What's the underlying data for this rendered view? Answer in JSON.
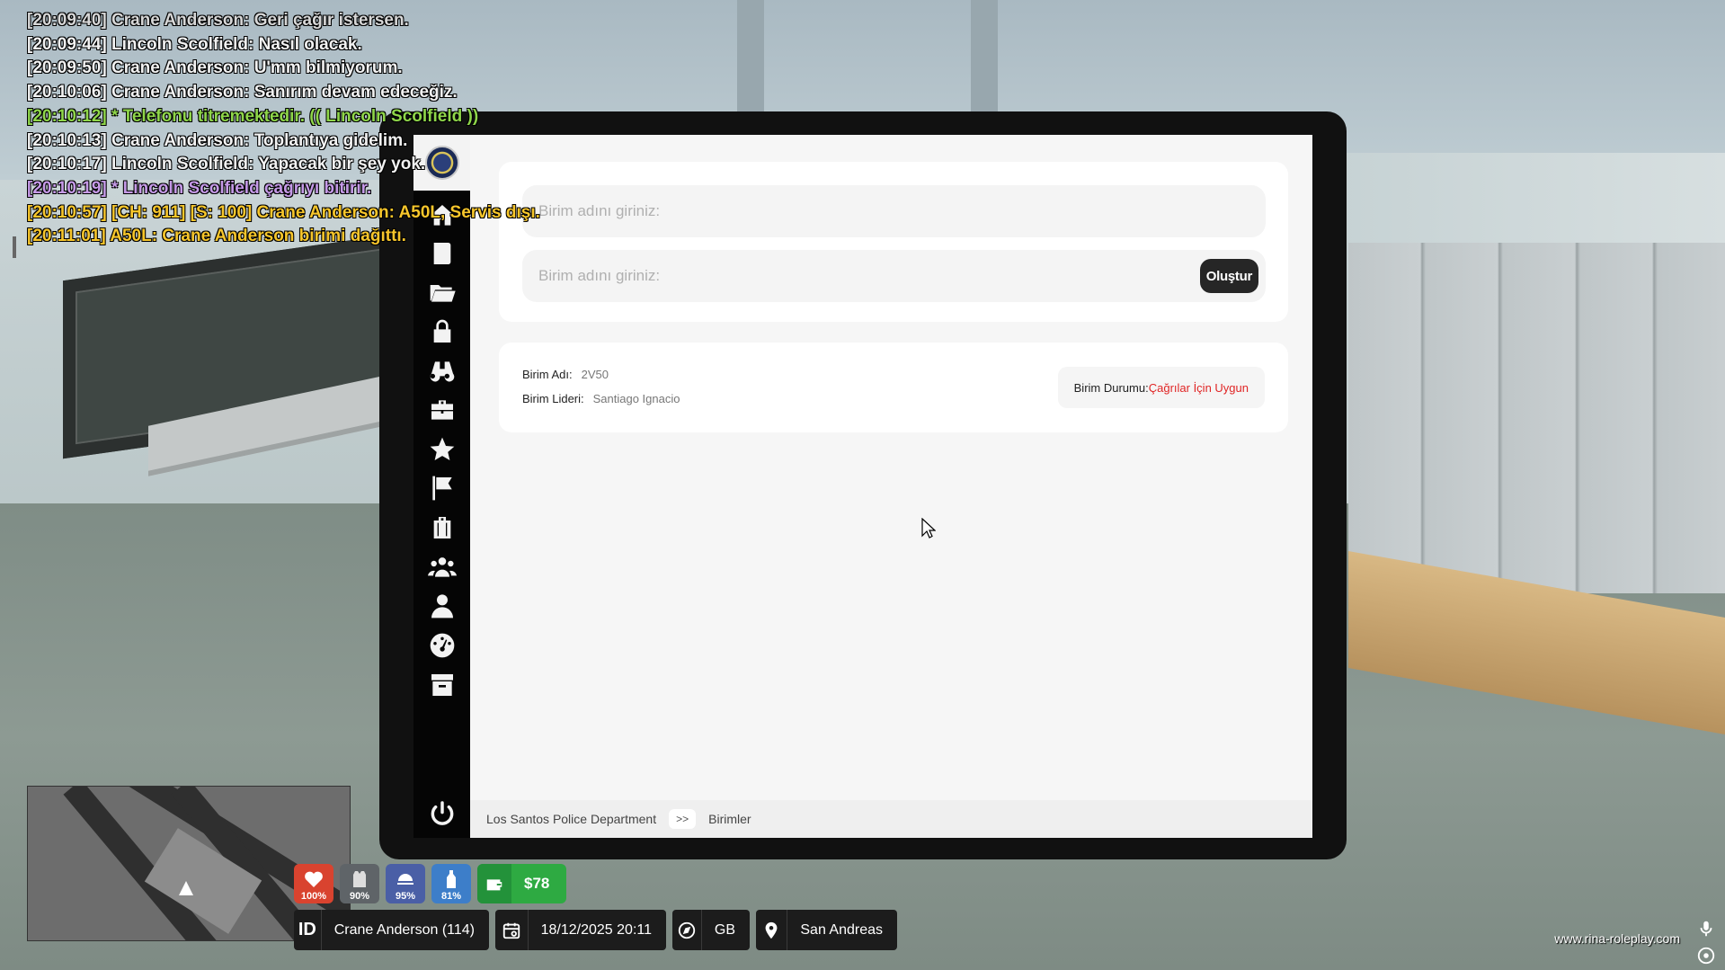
{
  "chat": [
    {
      "text": "[20:09:40] Crane Anderson: Geri çağır istersen.",
      "color": "grey"
    },
    {
      "text": "[20:09:44] Lincoln Scolfield: Nasıl olacak.",
      "color": "white"
    },
    {
      "text": "[20:09:50] Crane Anderson: U'mm bilmiyorum.",
      "color": "white"
    },
    {
      "text": "[20:10:06] Crane Anderson: Sanırım devam edeceğiz.",
      "color": "white"
    },
    {
      "text": "[20:10:12] * Telefonu titremektedir. (( Lincoln Scolfield ))",
      "color": "green"
    },
    {
      "text": "[20:10:13] Crane Anderson: Toplantıya gidelim.",
      "color": "white"
    },
    {
      "text": "[20:10:17] Lincoln Scolfield: Yapacak bir şey yok.",
      "color": "white"
    },
    {
      "text": "[20:10:19] * Lincoln Scolfield çağrıyı bitirir.",
      "color": "purple"
    },
    {
      "text": "[20:10:57] [CH: 911] [S: 100] Crane Anderson: A50L, Servis dışı.",
      "color": "yellow"
    },
    {
      "text": "[20:11:01] A50L: Crane Anderson birimi dağıttı.",
      "color": "yellow"
    }
  ],
  "tablet": {
    "sidebar_icons": [
      "home-icon",
      "book-icon",
      "folder-open-icon",
      "lock-icon",
      "binoculars-icon",
      "briefcase-icon",
      "star-icon",
      "flag-icon",
      "suitcase-icon",
      "users-icon",
      "user-icon",
      "tachometer-icon",
      "archive-icon"
    ],
    "form": {
      "field1_placeholder": "Birim adını giriniz:",
      "field2_placeholder": "Birim adını giriniz:",
      "create_label": "Oluştur"
    },
    "unit": {
      "name_label": "Birim Adı:",
      "name_value": "2V50",
      "leader_label": "Birim Lideri:",
      "leader_value": "Santiago Ignacio",
      "status_label": "Birim Durumu:",
      "status_value": "Çağrılar İçin Uygun"
    },
    "breadcrumb": {
      "root": "Los Santos Police Department",
      "separator": ">>",
      "current": "Birimler"
    }
  },
  "hud": {
    "stats": [
      {
        "name": "health",
        "value": "100%",
        "color": "#d9432f"
      },
      {
        "name": "armor",
        "value": "90%",
        "color": "#5f6468"
      },
      {
        "name": "hunger",
        "value": "95%",
        "color": "#4a5fa6"
      },
      {
        "name": "thirst",
        "value": "81%",
        "color": "#3d7ec9"
      }
    ],
    "money": "$78",
    "id_label": "ID",
    "player": "Crane Anderson (114)",
    "datetime": "18/12/2025 20:11",
    "direction": "GB",
    "location": "San Andreas",
    "watermark": "www.rina-roleplay.com"
  }
}
